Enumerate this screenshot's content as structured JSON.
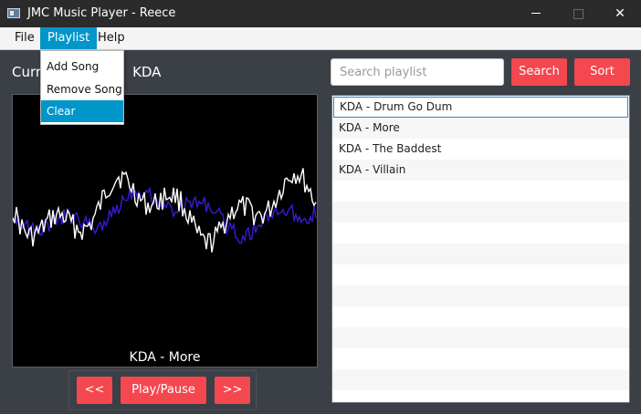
{
  "window": {
    "title": "JMC Music Player - Reece",
    "minimize_symbol": "",
    "maximize_symbol": "",
    "close_symbol": "✕"
  },
  "menu": {
    "items": [
      {
        "label": "File"
      },
      {
        "label": "Playlist",
        "active": true
      },
      {
        "label": "Help"
      }
    ],
    "playlist_dropdown": [
      "Add Song",
      "Remove Song",
      "Clear"
    ],
    "highlighted_dropdown_item": "Clear"
  },
  "current_song_label": "Curr",
  "current_song_label_tail": "KDA",
  "visualizer": {
    "now_playing": "KDA - More",
    "series_colors": [
      "#ffffff",
      "#3b19d6"
    ]
  },
  "controls": {
    "prev_label": "<<",
    "play_pause_label": "Play/Pause",
    "next_label": ">>"
  },
  "search": {
    "placeholder": "Search playlist",
    "value": "",
    "search_label": "Search",
    "sort_label": "Sort"
  },
  "playlist": {
    "songs": [
      "KDA - Drum Go Dum",
      "KDA - More",
      "KDA - The Baddest",
      "KDA - Villain"
    ],
    "selected_index": 0
  },
  "colors": {
    "accent_red": "#f4474f",
    "menu_highlight": "#0096c9",
    "background": "#3b3f46"
  }
}
